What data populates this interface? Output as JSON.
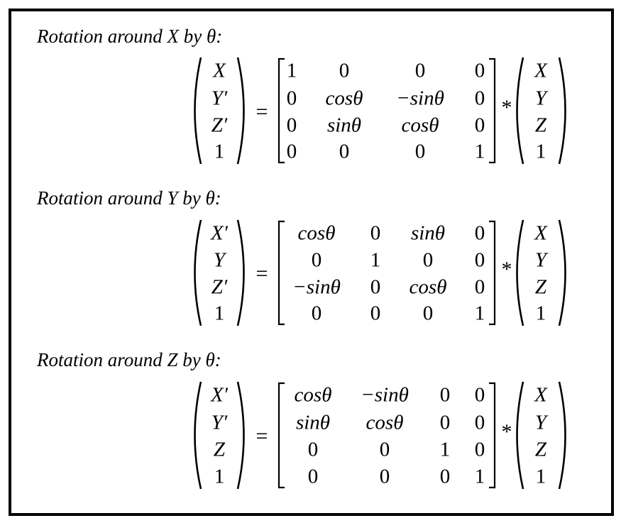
{
  "sections": [
    {
      "title": "Rotation around X by θ:",
      "lhs": [
        "X",
        "Y′",
        "Z′",
        "1"
      ],
      "matrix": [
        [
          "1",
          "0",
          "0",
          "0"
        ],
        [
          "0",
          "cosθ",
          "−sinθ",
          "0"
        ],
        [
          "0",
          "sinθ",
          "cosθ",
          "0"
        ],
        [
          "0",
          "0",
          "0",
          "1"
        ]
      ],
      "equals": "=",
      "times": "*",
      "rhs": [
        "X",
        "Y",
        "Z",
        "1"
      ]
    },
    {
      "title": "Rotation around Y by θ:",
      "lhs": [
        "X′",
        "Y",
        "Z′",
        "1"
      ],
      "matrix": [
        [
          "cosθ",
          "0",
          "sinθ",
          "0"
        ],
        [
          "0",
          "1",
          "0",
          "0"
        ],
        [
          "−sinθ",
          "0",
          "cosθ",
          "0"
        ],
        [
          "0",
          "0",
          "0",
          "1"
        ]
      ],
      "equals": "=",
      "times": "*",
      "rhs": [
        "X",
        "Y",
        "Z",
        "1"
      ]
    },
    {
      "title": "Rotation around Z by θ:",
      "lhs": [
        "X′",
        "Y′",
        "Z",
        "1"
      ],
      "matrix": [
        [
          "cosθ",
          "−sinθ",
          "0",
          "0"
        ],
        [
          "sinθ",
          "cosθ",
          "0",
          "0"
        ],
        [
          "0",
          "0",
          "1",
          "0"
        ],
        [
          "0",
          "0",
          "0",
          "1"
        ]
      ],
      "equals": "=",
      "times": "*",
      "rhs": [
        "X",
        "Y",
        "Z",
        "1"
      ]
    }
  ]
}
